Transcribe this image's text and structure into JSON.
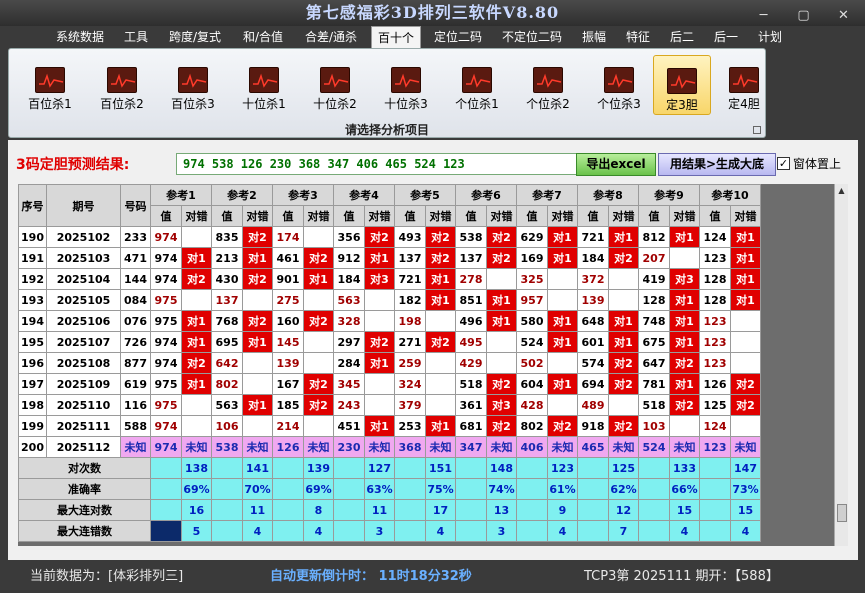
{
  "window": {
    "title": "第七感福彩3D排列三软件V8.80",
    "minimize": "─",
    "maximize": "▢",
    "close": "✕"
  },
  "menu": [
    "系统数据",
    "工具",
    "跨度/复式",
    "和/合值",
    "合差/通杀",
    "百十个",
    "定位二码",
    "不定位二码",
    "振幅",
    "特征",
    "后二",
    "后一",
    "计划"
  ],
  "ribbon": {
    "buttons": [
      "百位杀1",
      "百位杀2",
      "百位杀3",
      "十位杀1",
      "十位杀2",
      "十位杀3",
      "个位杀1",
      "个位杀2",
      "个位杀3",
      "定3胆",
      "定4胆"
    ],
    "selected": "定3胆",
    "caption": "请选择分析项目"
  },
  "result": {
    "label": "3码定胆预测结果:",
    "value": "974 538 126 230 368 347 406 465 524 123",
    "export_btn": "导出excel",
    "gen_btn": "用结果>生成大底",
    "ontop_label": "窗体置上",
    "ontop_checked": "✓"
  },
  "table": {
    "col_headers": {
      "seq": "序号",
      "period": "期号",
      "code": "号码"
    },
    "refs": [
      "参考1",
      "参考2",
      "参考3",
      "参考4",
      "参考5",
      "参考6",
      "参考7",
      "参考8",
      "参考9",
      "参考10"
    ],
    "sub_value": "值",
    "sub_check": "对错",
    "rows": [
      {
        "seq": "190",
        "period": "2025102",
        "code": "233",
        "cells": [
          [
            "974",
            ""
          ],
          [
            "835",
            "对2"
          ],
          [
            "174",
            ""
          ],
          [
            "356",
            "对2"
          ],
          [
            "493",
            "对2"
          ],
          [
            "538",
            "对2"
          ],
          [
            "629",
            "对1"
          ],
          [
            "721",
            "对1"
          ],
          [
            "812",
            "对1"
          ],
          [
            "124",
            "对1"
          ]
        ]
      },
      {
        "seq": "191",
        "period": "2025103",
        "code": "471",
        "cells": [
          [
            "974",
            "对1"
          ],
          [
            "213",
            "对1"
          ],
          [
            "461",
            "对2"
          ],
          [
            "912",
            "对1"
          ],
          [
            "137",
            "对2"
          ],
          [
            "137",
            "对2"
          ],
          [
            "169",
            "对1"
          ],
          [
            "184",
            "对2"
          ],
          [
            "207",
            ""
          ],
          [
            "123",
            "对1"
          ]
        ]
      },
      {
        "seq": "192",
        "period": "2025104",
        "code": "144",
        "cells": [
          [
            "974",
            "对2"
          ],
          [
            "430",
            "对2"
          ],
          [
            "901",
            "对1"
          ],
          [
            "184",
            "对3"
          ],
          [
            "721",
            "对1"
          ],
          [
            "278",
            ""
          ],
          [
            "325",
            ""
          ],
          [
            "372",
            ""
          ],
          [
            "419",
            "对3"
          ],
          [
            "128",
            "对1"
          ]
        ]
      },
      {
        "seq": "193",
        "period": "2025105",
        "code": "084",
        "cells": [
          [
            "975",
            ""
          ],
          [
            "137",
            ""
          ],
          [
            "275",
            ""
          ],
          [
            "563",
            ""
          ],
          [
            "182",
            "对1"
          ],
          [
            "851",
            "对1"
          ],
          [
            "957",
            ""
          ],
          [
            "139",
            ""
          ],
          [
            "128",
            "对1"
          ],
          [
            "128",
            "对1"
          ]
        ]
      },
      {
        "seq": "194",
        "period": "2025106",
        "code": "076",
        "cells": [
          [
            "975",
            "对1"
          ],
          [
            "768",
            "对2"
          ],
          [
            "160",
            "对2"
          ],
          [
            "328",
            ""
          ],
          [
            "198",
            ""
          ],
          [
            "496",
            "对1"
          ],
          [
            "580",
            "对1"
          ],
          [
            "648",
            "对1"
          ],
          [
            "748",
            "对1"
          ],
          [
            "123",
            ""
          ]
        ]
      },
      {
        "seq": "195",
        "period": "2025107",
        "code": "726",
        "cells": [
          [
            "974",
            "对1"
          ],
          [
            "695",
            "对1"
          ],
          [
            "145",
            ""
          ],
          [
            "297",
            "对2"
          ],
          [
            "271",
            "对2"
          ],
          [
            "495",
            ""
          ],
          [
            "524",
            "对1"
          ],
          [
            "601",
            "对1"
          ],
          [
            "675",
            "对1"
          ],
          [
            "123",
            ""
          ]
        ]
      },
      {
        "seq": "196",
        "period": "2025108",
        "code": "877",
        "cells": [
          [
            "974",
            "对2"
          ],
          [
            "642",
            ""
          ],
          [
            "139",
            ""
          ],
          [
            "284",
            "对1"
          ],
          [
            "259",
            ""
          ],
          [
            "429",
            ""
          ],
          [
            "502",
            ""
          ],
          [
            "574",
            "对2"
          ],
          [
            "647",
            "对2"
          ],
          [
            "123",
            ""
          ]
        ]
      },
      {
        "seq": "197",
        "period": "2025109",
        "code": "619",
        "cells": [
          [
            "975",
            "对1"
          ],
          [
            "802",
            ""
          ],
          [
            "167",
            "对2"
          ],
          [
            "345",
            ""
          ],
          [
            "324",
            ""
          ],
          [
            "518",
            "对2"
          ],
          [
            "604",
            "对1"
          ],
          [
            "694",
            "对2"
          ],
          [
            "781",
            "对1"
          ],
          [
            "126",
            "对2"
          ]
        ]
      },
      {
        "seq": "198",
        "period": "2025110",
        "code": "116",
        "cells": [
          [
            "975",
            ""
          ],
          [
            "563",
            "对1"
          ],
          [
            "185",
            "对2"
          ],
          [
            "243",
            ""
          ],
          [
            "379",
            ""
          ],
          [
            "361",
            "对3"
          ],
          [
            "428",
            ""
          ],
          [
            "489",
            ""
          ],
          [
            "518",
            "对2"
          ],
          [
            "125",
            "对2"
          ]
        ]
      },
      {
        "seq": "199",
        "period": "2025111",
        "code": "588",
        "cells": [
          [
            "974",
            ""
          ],
          [
            "106",
            ""
          ],
          [
            "214",
            ""
          ],
          [
            "451",
            "对1"
          ],
          [
            "253",
            "对1"
          ],
          [
            "681",
            "对2"
          ],
          [
            "802",
            "对2"
          ],
          [
            "918",
            "对2"
          ],
          [
            "103",
            ""
          ],
          [
            "124",
            ""
          ]
        ]
      },
      {
        "seq": "200",
        "period": "2025112",
        "code": "未知",
        "unknown": true,
        "cells": [
          [
            "974",
            "未知"
          ],
          [
            "538",
            "未知"
          ],
          [
            "126",
            "未知"
          ],
          [
            "230",
            "未知"
          ],
          [
            "368",
            "未知"
          ],
          [
            "347",
            "未知"
          ],
          [
            "406",
            "未知"
          ],
          [
            "465",
            "未知"
          ],
          [
            "524",
            "未知"
          ],
          [
            "123",
            "未知"
          ]
        ]
      }
    ],
    "stats": [
      {
        "label": "对次数",
        "values": [
          "138",
          "141",
          "139",
          "127",
          "151",
          "148",
          "123",
          "125",
          "133",
          "147"
        ]
      },
      {
        "label": "准确率",
        "values": [
          "69%",
          "70%",
          "69%",
          "63%",
          "75%",
          "74%",
          "61%",
          "62%",
          "66%",
          "73%"
        ]
      },
      {
        "label": "最大连对数",
        "values": [
          "16",
          "11",
          "8",
          "11",
          "17",
          "13",
          "9",
          "12",
          "15",
          "15"
        ]
      },
      {
        "label": "最大连错数",
        "values": [
          "5",
          "4",
          "4",
          "3",
          "4",
          "3",
          "4",
          "7",
          "4",
          "4"
        ]
      }
    ]
  },
  "status": {
    "current_data": "当前数据为：[体彩排列三]",
    "countdown": "自动更新倒计时： 11时18分32秒",
    "period_info": "TCP3第 2025111 期开：【588】"
  },
  "colors": {
    "hit": "#e00000",
    "unknown": "#f0a8f0",
    "stats": "#7ff0f0",
    "result_text": "#007000",
    "countdown": "#6ab0ff"
  },
  "icons": [
    "trend-chart-icon"
  ]
}
